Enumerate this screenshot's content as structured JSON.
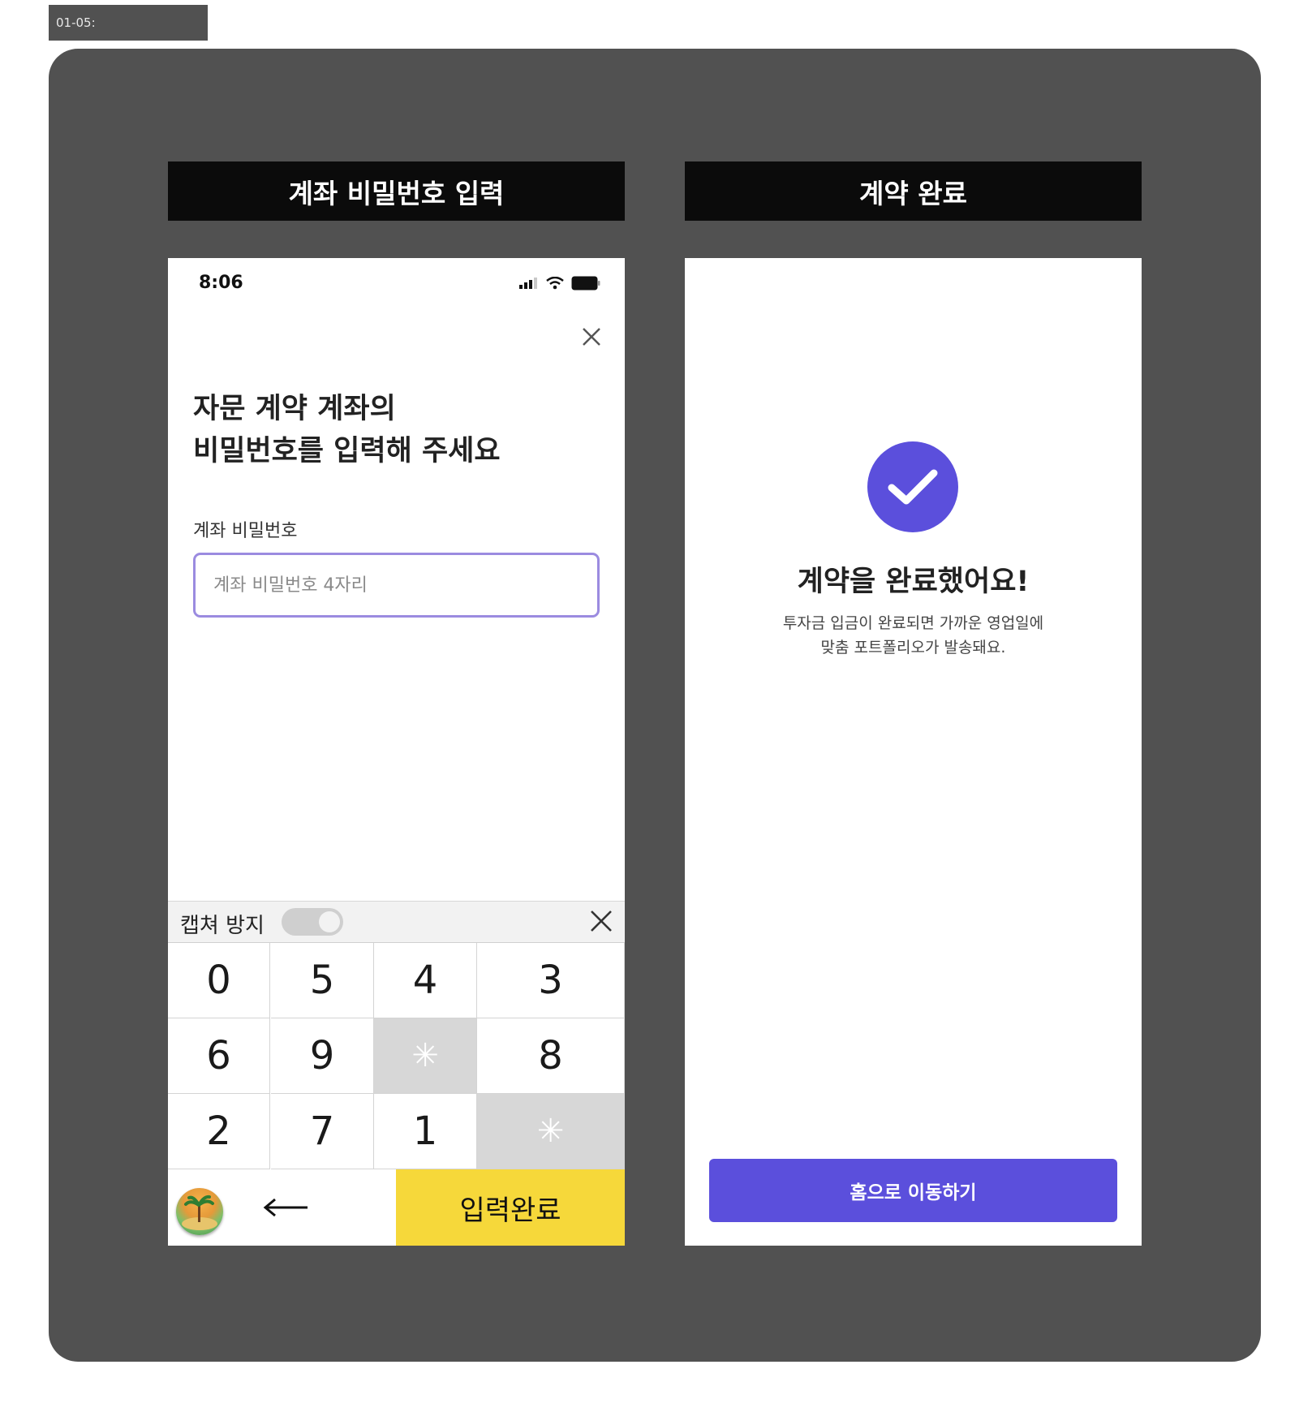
{
  "frame_tag": "01-05:",
  "left": {
    "title": "계좌 비밀번호 입력",
    "status_time": "8:06",
    "heading_line1": "자문 계약 계좌의",
    "heading_line2": "비밀번호를 입력해 주세요",
    "field_label": "계좌 비밀번호",
    "field_placeholder": "계좌 비밀번호 4자리",
    "field_value": "",
    "keyboard": {
      "capture_label": "캡쳐 방지",
      "capture_toggle": "on",
      "rows": [
        [
          "0",
          "5",
          "4",
          "3"
        ],
        [
          "6",
          "9",
          "",
          "8"
        ],
        [
          "2",
          "7",
          "1",
          ""
        ]
      ],
      "blank_key_glyph": "✳",
      "done_label": "입력완료",
      "back_icon": "left-arrow-icon",
      "logo_icon": "island-logo-icon"
    }
  },
  "right": {
    "title": "계약 완료",
    "done_title": "계약을 완료했어요!",
    "desc_line1": "투자금 입금이 완료되면 가까운 영업일에",
    "desc_line2": "맞춤 포트폴리오가 발송돼요.",
    "home_button": "홈으로 이동하기",
    "icon": "check-circle-icon"
  },
  "colors": {
    "board_bg": "#515151",
    "title_bar_bg": "#0b0b0b",
    "accent_purple": "#5b4fdc",
    "input_border": "#9b8be0",
    "done_key_yellow": "#f6d83a",
    "gray_key": "#d7d7d7"
  }
}
